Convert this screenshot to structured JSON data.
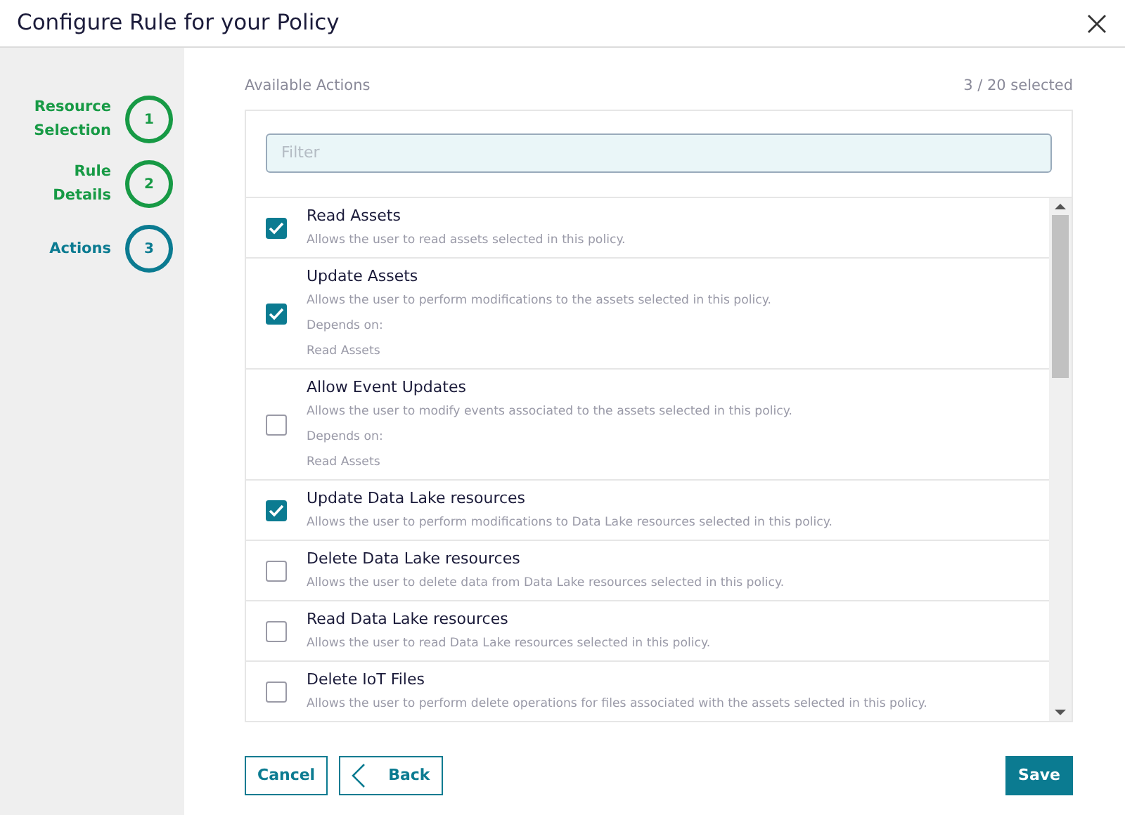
{
  "window": {
    "title": "Configure Rule for your Policy"
  },
  "steps": [
    {
      "label": "Resource Selection",
      "number": "1",
      "selected": false
    },
    {
      "label": "Rule Details",
      "number": "2",
      "selected": false
    },
    {
      "label": "Actions",
      "number": "3",
      "selected": true
    }
  ],
  "actions_panel": {
    "heading": "Available Actions",
    "count": "3 / 20 selected",
    "filter": {
      "placeholder": "Filter"
    },
    "items": [
      {
        "title": "Read Assets",
        "description": "Allows the user to read assets selected in this policy.",
        "checked": true
      },
      {
        "title": "Update Assets",
        "description": "Allows the user to perform modifications to the assets selected in this policy.",
        "depends_label": "Depends on:",
        "depends": "Read Assets",
        "checked": true
      },
      {
        "title": "Allow Event Updates",
        "description": "Allows the user to modify events associated to the assets selected in this policy.",
        "depends_label": "Depends on:",
        "depends": "Read Assets",
        "checked": false
      },
      {
        "title": "Update Data Lake resources",
        "description": "Allows the user to perform modifications to Data Lake resources selected in this policy.",
        "checked": true
      },
      {
        "title": "Delete Data Lake resources",
        "description": "Allows the user to delete data from Data Lake resources selected in this policy.",
        "checked": false
      },
      {
        "title": "Read Data Lake resources",
        "description": "Allows the user to read Data Lake resources selected in this policy.",
        "checked": false
      },
      {
        "title": "Delete IoT Files",
        "description": "Allows the user to perform delete operations for files associated with the assets selected in this policy.",
        "checked": false
      }
    ]
  },
  "buttons": {
    "cancel": "Cancel",
    "back": "Back",
    "save": "Save"
  }
}
